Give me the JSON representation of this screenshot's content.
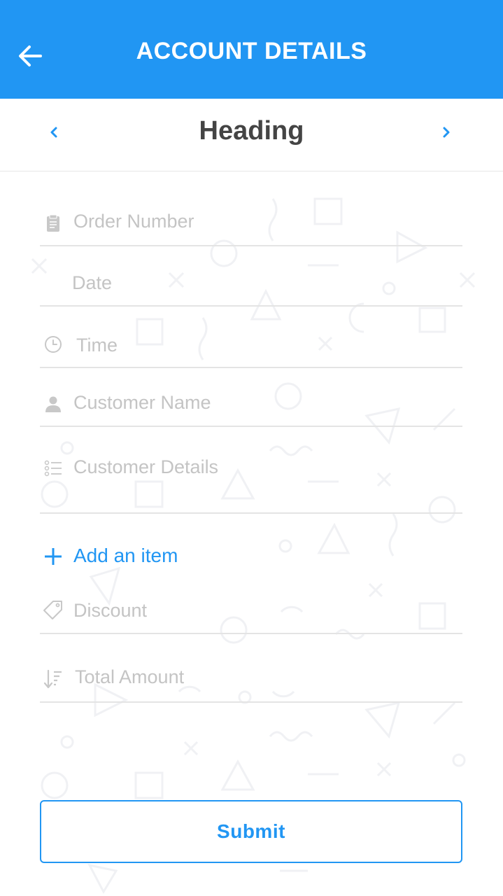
{
  "appbar": {
    "title": "ACCOUNT DETAILS"
  },
  "subheader": {
    "heading": "Heading"
  },
  "form": {
    "order_number": {
      "placeholder": "Order Number",
      "icon": "clipboard-icon"
    },
    "date": {
      "placeholder": "Date"
    },
    "time": {
      "placeholder": "Time",
      "icon": "clock-icon"
    },
    "customer_name": {
      "placeholder": "Customer Name",
      "icon": "person-icon"
    },
    "customer_details": {
      "placeholder": "Customer Details",
      "icon": "list-icon"
    },
    "add_item": {
      "label": "Add an item",
      "icon": "plus-icon"
    },
    "discount": {
      "placeholder": "Discount",
      "icon": "tag-icon"
    },
    "total_amount": {
      "placeholder": "Total Amount",
      "icon": "sort-icon"
    }
  },
  "submit_label": "Submit",
  "colors": {
    "primary": "#2196f3",
    "placeholder": "#c4c4c4",
    "heading": "#444444"
  }
}
